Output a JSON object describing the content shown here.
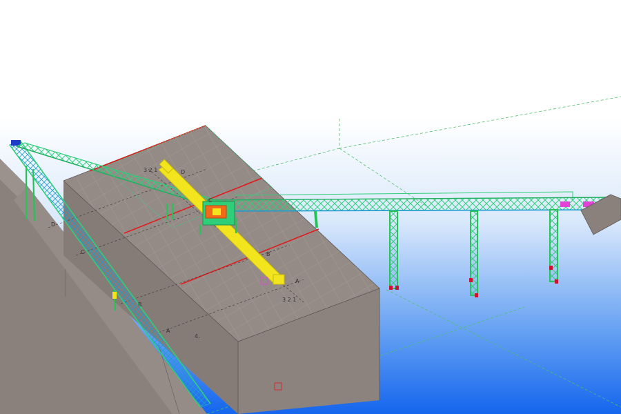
{
  "grid_labels": {
    "label_321_top": "3 2 1",
    "label_d_top": "D",
    "label_c_top": "C",
    "label_b_top": "B",
    "label_a_right": "A",
    "label_321_bottom": "3 2 1",
    "label_d_left": "D",
    "label_c_left": "C",
    "label_b_left": "B",
    "label_a_bottom": "A",
    "label_4_bottom": "4."
  },
  "colors": {
    "sky_top": "#ffffff",
    "sky_bottom": "#1e6cf0",
    "building": "#8d8380",
    "building_top": "#9a908c",
    "truss": "#2fcf7a",
    "steel": "#26c457",
    "crane": "#f2e51e",
    "accent_red": "#e21a1a",
    "foot": "#cc1133",
    "head_blue": "#1f3cc8"
  }
}
